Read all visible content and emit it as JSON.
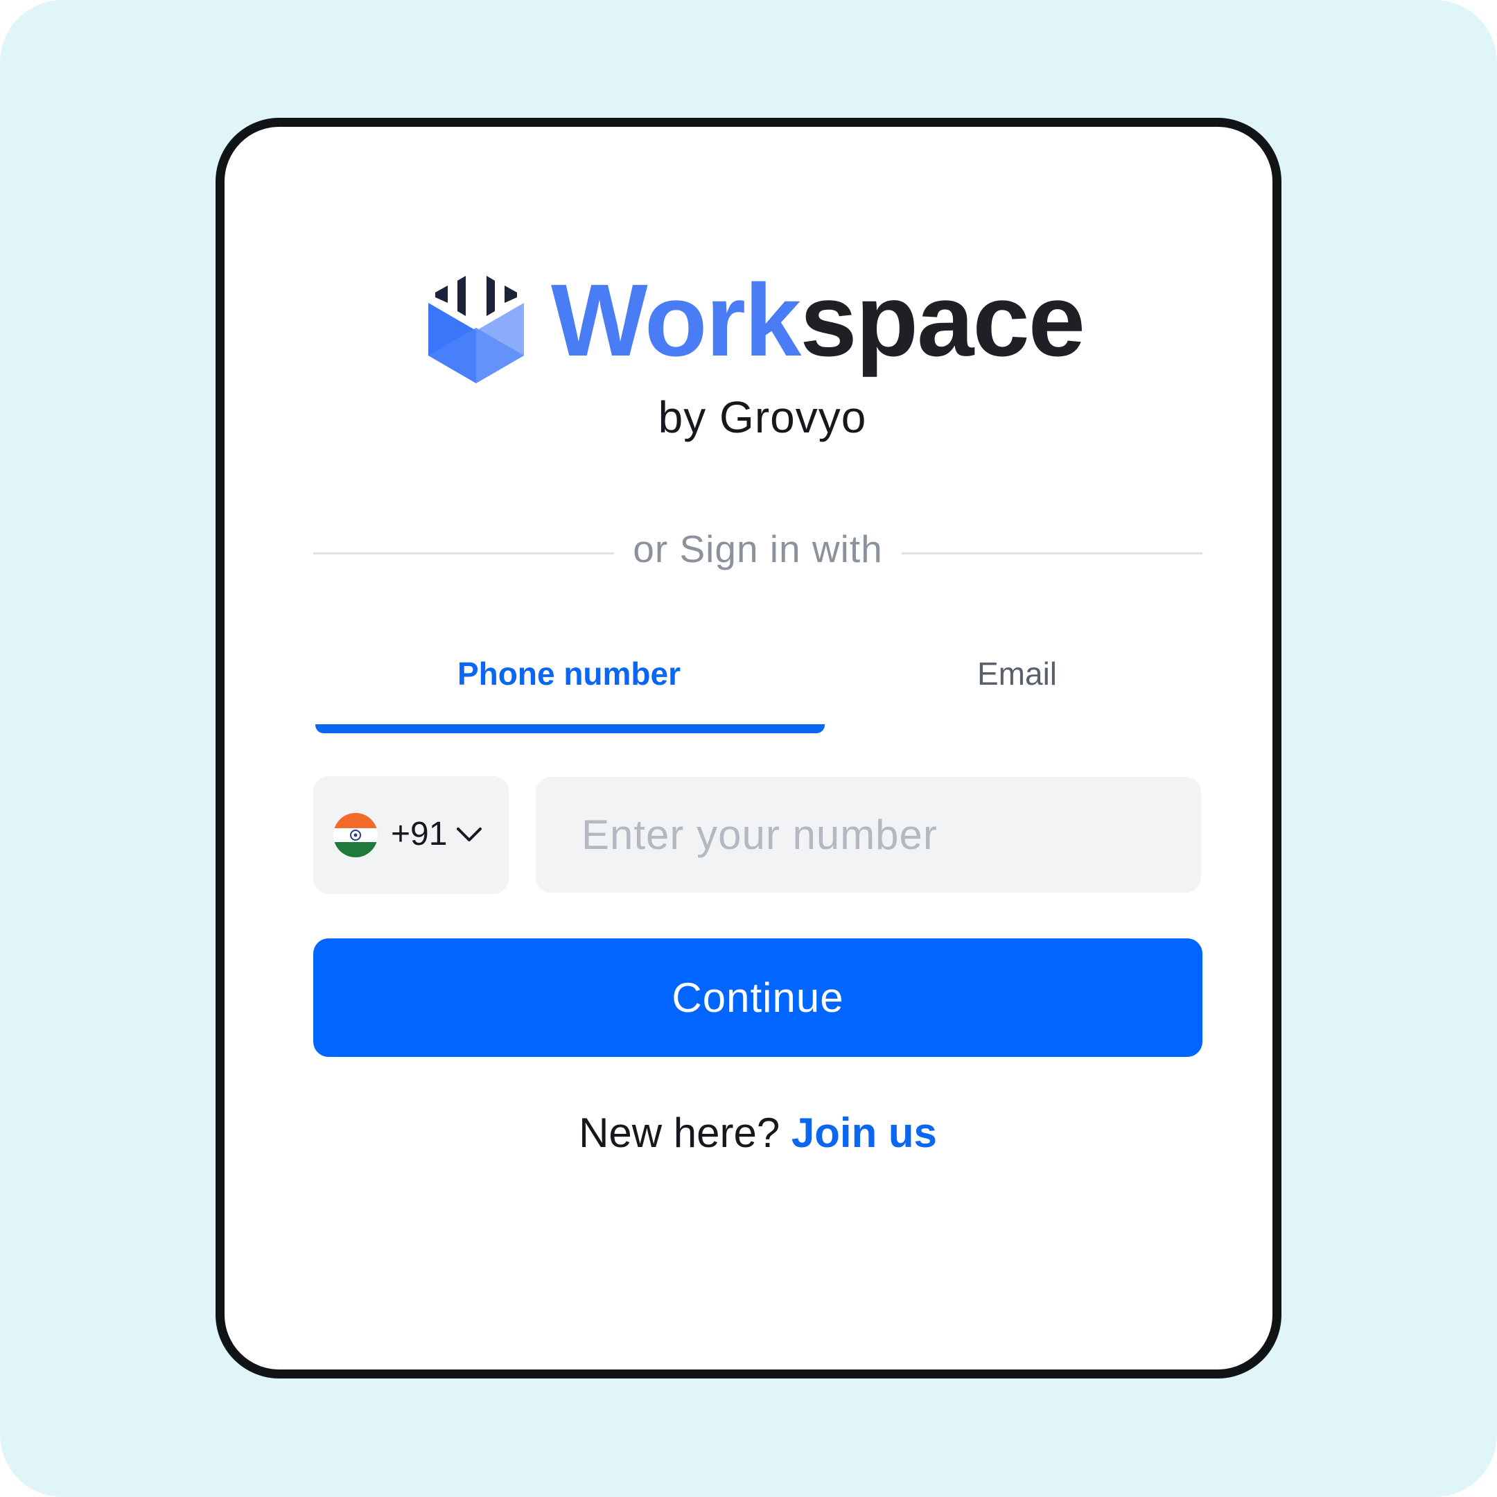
{
  "brand": {
    "name_part_1": "Work",
    "name_part_2": "space",
    "byline": "by Grovyo",
    "logo_icon": "workspace-logo-icon"
  },
  "divider_text": "or Sign in with",
  "tabs": [
    {
      "label": "Phone number",
      "active": true
    },
    {
      "label": "Email",
      "active": false
    }
  ],
  "phone": {
    "country_flag_icon": "india-flag-icon",
    "country_code": "+91",
    "dropdown_icon": "chevron-down-icon",
    "placeholder": "Enter your number",
    "value": ""
  },
  "continue_label": "Continue",
  "footer": {
    "prompt": "New here? ",
    "link_label": "Join us"
  },
  "colors": {
    "accent": "#0066ff",
    "brand_blue": "#4a7df5",
    "background": "#dff5f7"
  }
}
